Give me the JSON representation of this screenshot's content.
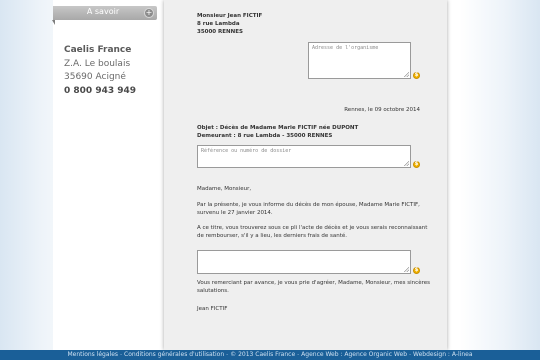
{
  "sidebar": {
    "tab_label": "A savoir",
    "tab_icon": "plus-icon",
    "company_name": "Caelis France",
    "address_line1": "Z.A. Le boulais",
    "address_line2": "35690 Acigné",
    "phone": "0 800 943 949"
  },
  "letter": {
    "sender_name": "Monsieur Jean FICTIF",
    "sender_street": "8 rue Lambda",
    "sender_city": "35000 RENNES",
    "org_placeholder": "Adresse de l'organisme",
    "date_line": "Rennes, le 09 octobre 2014",
    "subject": "Objet : Décès de Madame Marie FICTIF née DUPONT",
    "residence": "Demeurant : 8 rue Lambda - 35000 RENNES",
    "ref_placeholder": "Référence ou numéro de dossier",
    "salutation": "Madame, Monsieur,",
    "para1_line1": "Par la présente, je vous informe du décès de mon épouse, Madame Marie FICTIF,",
    "para1_line2": "survenu le 27 janvier 2014.",
    "para2_line1": "A ce titre, vous trouverez sous ce pli l'acte de décès et je vous serais reconnaissant",
    "para2_line2": "de rembourser, s'il y a lieu, les derniers frais de santé.",
    "closing_line1": "Vous remerciant par avance, je vous prie d'agréer, Madame, Monsieur, mes sincères",
    "closing_line2": "salutations.",
    "signature": "Jean FICTIF",
    "help_icon_glyph": "$"
  },
  "footer": {
    "links": [
      "Mentions légales",
      "Conditions générales d'utilisation",
      "© 2013 Caelis France",
      "Agence Web : Agence Organic Web",
      "Webdesign : A-linea"
    ],
    "separator": "-"
  },
  "colors": {
    "footer_bg": "#1a5f98",
    "help_icon": "#f2b300",
    "paper": "#efefef"
  }
}
